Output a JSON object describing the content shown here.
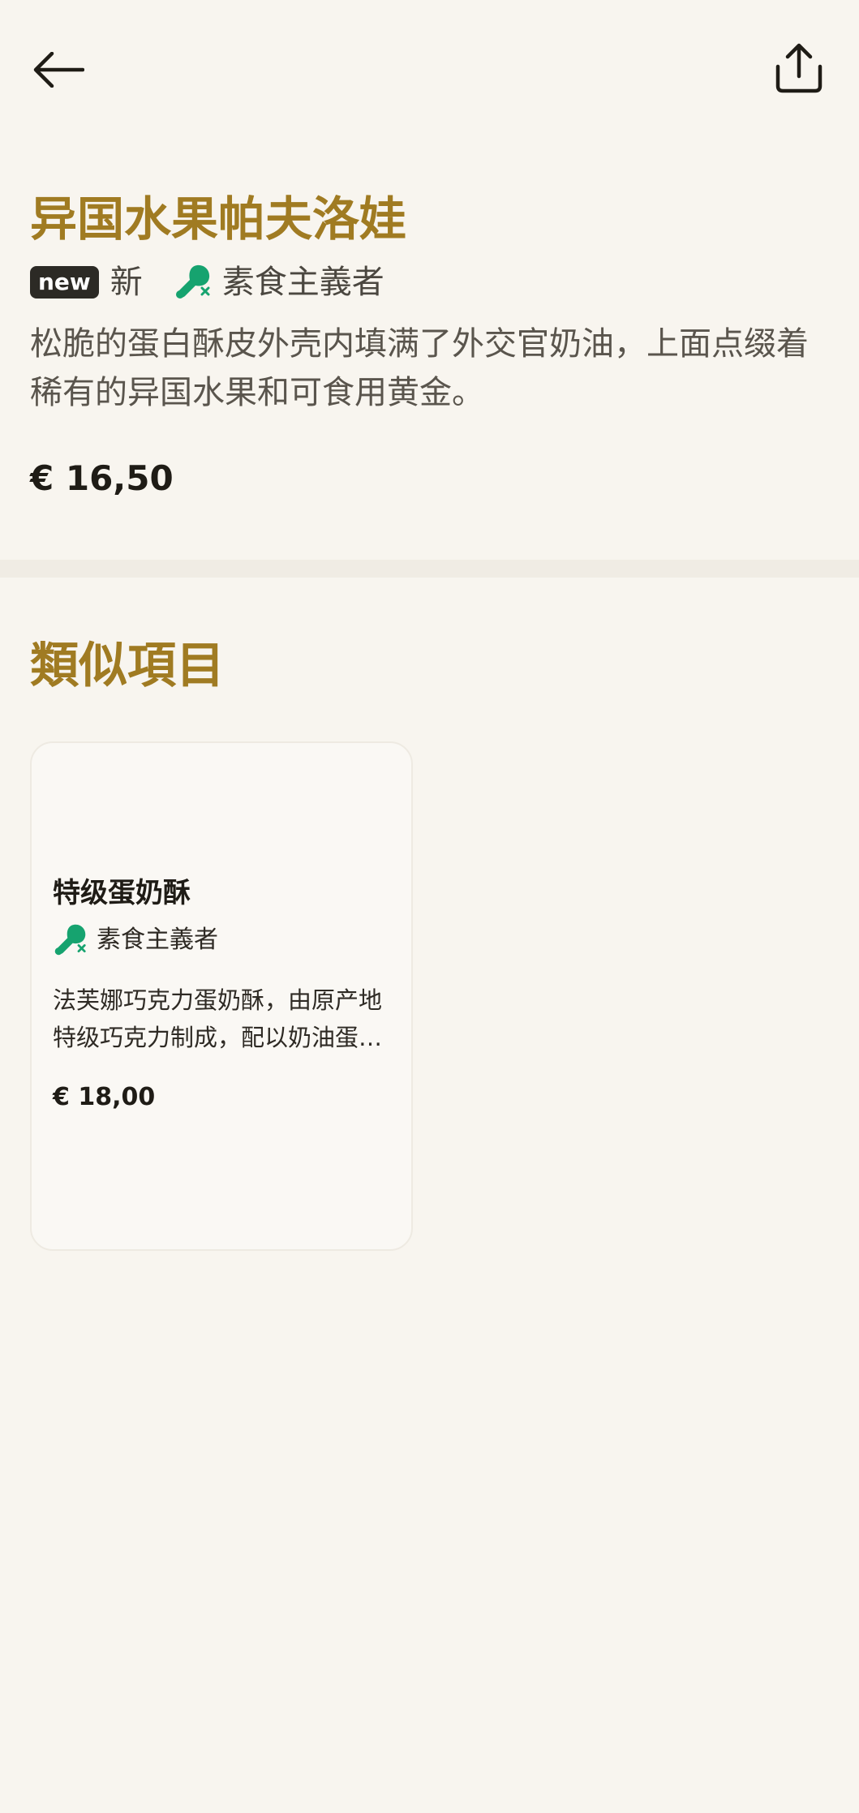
{
  "header": {
    "back_icon": "arrow-left-icon",
    "share_icon": "share-upload-icon"
  },
  "product": {
    "title": "异国水果帕夫洛娃",
    "new_badge": "new",
    "new_label": "新",
    "vegetarian_label": "素食主義者",
    "vegetarian_icon": "vegetarian-no-meat-icon",
    "description": "松脆的蛋白酥皮外壳内填满了外交官奶油，上面点缀着稀有的异国水果和可食用黄金。",
    "price": "€ 16,50"
  },
  "similar": {
    "section_title": "類似項目",
    "items": [
      {
        "title": "特级蛋奶酥",
        "vegetarian_label": "素食主義者",
        "vegetarian_icon": "vegetarian-no-meat-icon",
        "description": "法芙娜巧克力蛋奶酥，由原产地特级巧克力制成，配以奶油蛋…",
        "price": "€ 18,00"
      }
    ]
  },
  "colors": {
    "background": "#f8f5ef",
    "accent": "#a07b22",
    "text": "#1f1c16",
    "muted_text": "#5a554d",
    "vegetarian_green": "#16a36f",
    "separator": "#f0ece4"
  }
}
